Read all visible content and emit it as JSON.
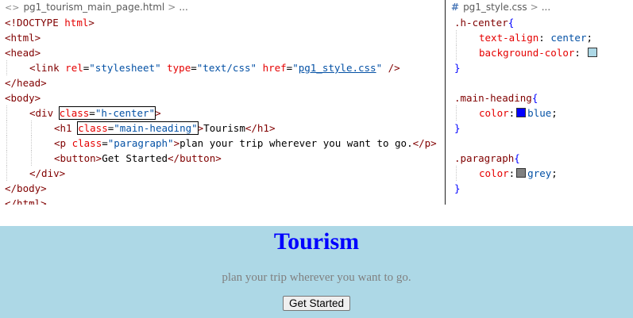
{
  "html_editor": {
    "breadcrumb": {
      "icon": "<>",
      "file": "pg1_tourism_main_page.html",
      "separator": ">",
      "more": "..."
    },
    "lines": [
      {
        "indent": 0,
        "parts": [
          {
            "t": "tag",
            "v": "<!DOCTYPE"
          },
          {
            "t": "txt",
            "v": " "
          },
          {
            "t": "attr",
            "v": "html"
          },
          {
            "t": "tag",
            "v": ">"
          }
        ]
      },
      {
        "indent": 0,
        "parts": [
          {
            "t": "tag",
            "v": "<html>"
          }
        ]
      },
      {
        "indent": 0,
        "parts": [
          {
            "t": "tag",
            "v": "<head>"
          }
        ]
      },
      {
        "indent": 1,
        "parts": [
          {
            "t": "tag",
            "v": "<link"
          },
          {
            "t": "txt",
            "v": " "
          },
          {
            "t": "attr",
            "v": "rel"
          },
          {
            "t": "txt",
            "v": "="
          },
          {
            "t": "val",
            "v": "\"stylesheet\""
          },
          {
            "t": "txt",
            "v": " "
          },
          {
            "t": "attr",
            "v": "type"
          },
          {
            "t": "txt",
            "v": "="
          },
          {
            "t": "val",
            "v": "\"text/css\""
          },
          {
            "t": "txt",
            "v": " "
          },
          {
            "t": "attr",
            "v": "href"
          },
          {
            "t": "txt",
            "v": "="
          },
          {
            "t": "val",
            "v": "\""
          },
          {
            "t": "link",
            "v": "pg1_style.css"
          },
          {
            "t": "val",
            "v": "\""
          },
          {
            "t": "txt",
            "v": " "
          },
          {
            "t": "tag",
            "v": "/>"
          }
        ]
      },
      {
        "indent": 0,
        "parts": [
          {
            "t": "tag",
            "v": "</head>"
          }
        ]
      },
      {
        "indent": 0,
        "parts": [
          {
            "t": "tag",
            "v": "<body>"
          }
        ]
      },
      {
        "indent": 1,
        "parts": [
          {
            "t": "tag",
            "v": "<div"
          },
          {
            "t": "txt",
            "v": " "
          },
          {
            "t": "attr",
            "v": "class",
            "box": "start"
          },
          {
            "t": "txt",
            "v": "="
          },
          {
            "t": "val",
            "v": "\"h-center\"",
            "box": "end"
          },
          {
            "t": "tag",
            "v": ">"
          }
        ]
      },
      {
        "indent": 2,
        "parts": [
          {
            "t": "tag",
            "v": "<h1"
          },
          {
            "t": "txt",
            "v": " "
          },
          {
            "t": "attr",
            "v": "class",
            "box": "start"
          },
          {
            "t": "txt",
            "v": "="
          },
          {
            "t": "val",
            "v": "\"main-heading\"",
            "box": "end"
          },
          {
            "t": "tag",
            "v": ">"
          },
          {
            "t": "txt",
            "v": "Tourism"
          },
          {
            "t": "tag",
            "v": "</h1>"
          }
        ]
      },
      {
        "indent": 2,
        "parts": [
          {
            "t": "tag",
            "v": "<p"
          },
          {
            "t": "txt",
            "v": " "
          },
          {
            "t": "attr",
            "v": "class"
          },
          {
            "t": "txt",
            "v": "="
          },
          {
            "t": "val",
            "v": "\"paragraph\""
          },
          {
            "t": "tag",
            "v": ">"
          },
          {
            "t": "txt",
            "v": "plan your trip wherever you want to go."
          },
          {
            "t": "tag",
            "v": "</p>"
          }
        ]
      },
      {
        "indent": 2,
        "parts": [
          {
            "t": "tag",
            "v": "<button>"
          },
          {
            "t": "txt",
            "v": "Get Started"
          },
          {
            "t": "tag",
            "v": "</button>"
          }
        ]
      },
      {
        "indent": 1,
        "parts": [
          {
            "t": "tag",
            "v": "</div>"
          }
        ]
      },
      {
        "indent": 0,
        "parts": [
          {
            "t": "tag",
            "v": "</body>"
          }
        ]
      },
      {
        "indent": 0,
        "parts": [
          {
            "t": "tag",
            "v": "</html>"
          }
        ]
      }
    ]
  },
  "css_editor": {
    "breadcrumb": {
      "icon": "#",
      "file": "pg1_style.css",
      "separator": ">",
      "more": "..."
    },
    "lines": [
      {
        "indent": 0,
        "parts": [
          {
            "t": "sel",
            "v": ".h-center"
          },
          {
            "t": "brace",
            "v": "{"
          }
        ]
      },
      {
        "indent": 1,
        "parts": [
          {
            "t": "prop",
            "v": "text-align"
          },
          {
            "t": "txt",
            "v": ": "
          },
          {
            "t": "cssval",
            "v": "center"
          },
          {
            "t": "txt",
            "v": ";"
          }
        ]
      },
      {
        "indent": 1,
        "parts": [
          {
            "t": "prop",
            "v": "background-color"
          },
          {
            "t": "txt",
            "v": ": "
          },
          {
            "t": "swatch",
            "v": "#add8e6"
          }
        ]
      },
      {
        "indent": 0,
        "parts": [
          {
            "t": "brace",
            "v": "}"
          }
        ]
      },
      {
        "indent": 0,
        "parts": []
      },
      {
        "indent": 0,
        "parts": [
          {
            "t": "sel",
            "v": ".main-heading"
          },
          {
            "t": "brace",
            "v": "{"
          }
        ]
      },
      {
        "indent": 1,
        "parts": [
          {
            "t": "prop",
            "v": "color"
          },
          {
            "t": "txt",
            "v": ":"
          },
          {
            "t": "swatch",
            "v": "#0000ff"
          },
          {
            "t": "cssval",
            "v": "blue"
          },
          {
            "t": "txt",
            "v": ";"
          }
        ]
      },
      {
        "indent": 0,
        "parts": [
          {
            "t": "brace",
            "v": "}"
          }
        ]
      },
      {
        "indent": 0,
        "parts": []
      },
      {
        "indent": 0,
        "parts": [
          {
            "t": "sel",
            "v": ".paragraph"
          },
          {
            "t": "brace",
            "v": "{"
          }
        ]
      },
      {
        "indent": 1,
        "parts": [
          {
            "t": "prop",
            "v": "color"
          },
          {
            "t": "txt",
            "v": ":"
          },
          {
            "t": "swatch",
            "v": "#808080"
          },
          {
            "t": "cssval",
            "v": "grey"
          },
          {
            "t": "txt",
            "v": ";"
          }
        ]
      },
      {
        "indent": 0,
        "parts": [
          {
            "t": "brace",
            "v": "}"
          }
        ]
      }
    ]
  },
  "preview": {
    "heading": "Tourism",
    "paragraph": "plan your trip wherever you want to go.",
    "button_label": "Get Started",
    "background_color": "#add8e6",
    "heading_color": "#0000ff",
    "paragraph_color": "#808080"
  }
}
